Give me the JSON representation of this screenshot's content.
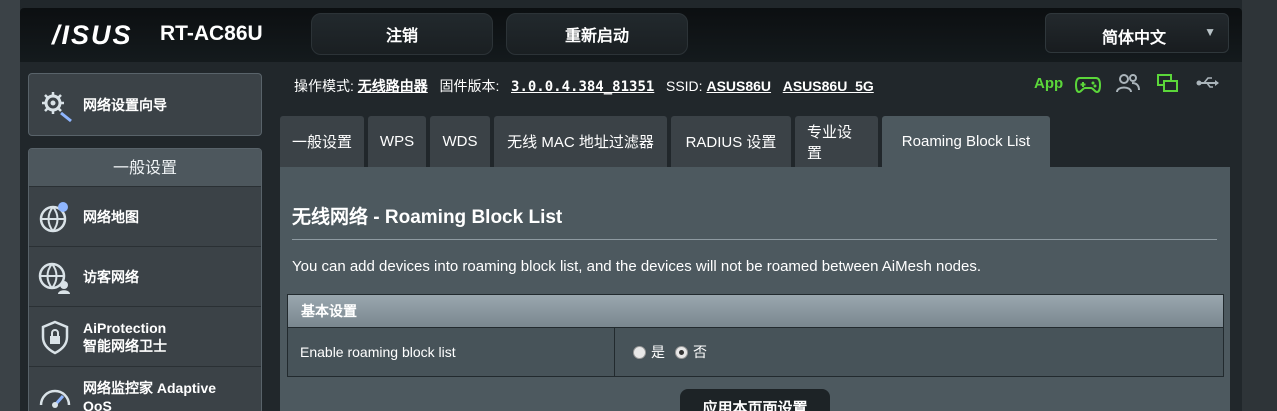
{
  "header": {
    "logo": "/ISUS",
    "model": "RT-AC86U",
    "logout_label": "注销",
    "reboot_label": "重新启动",
    "language": "简体中文"
  },
  "sidebar": {
    "wizard_label": "网络设置向导",
    "section_title": "一般设置",
    "items": [
      {
        "label": "网络地图",
        "icon": "globe-pin-icon"
      },
      {
        "label": "访客网络",
        "icon": "guest-network-icon"
      },
      {
        "label": "AiProtection\n智能网络卫士",
        "line1": "AiProtection",
        "line2": "智能网络卫士",
        "icon": "shield-lock-icon"
      },
      {
        "label": "网络监控家 Adaptive QoS",
        "line1": "网络监控家 Adaptive",
        "line2": "QoS",
        "icon": "speedometer-icon"
      }
    ]
  },
  "info": {
    "mode_label": "操作模式:",
    "mode_value": "无线路由器",
    "firmware_label": "固件版本:",
    "firmware_value": "3.0.0.4.384_81351",
    "ssid_label": "SSID:",
    "ssid_1": "ASUS86U",
    "ssid_2": "ASUS86U_5G",
    "app_label": "App"
  },
  "tabs": [
    {
      "label": "一般设置",
      "active": false
    },
    {
      "label": "WPS",
      "active": false
    },
    {
      "label": "WDS",
      "active": false
    },
    {
      "label": "无线 MAC 地址过滤器",
      "active": false
    },
    {
      "label": "RADIUS 设置",
      "active": false
    },
    {
      "label": "专业设置",
      "active": false
    },
    {
      "label": "Roaming Block List",
      "active": true
    }
  ],
  "panel": {
    "title": "无线网络 - Roaming Block List",
    "description": "You can add devices into roaming block list, and the devices will not be roamed between AiMesh nodes.",
    "table_header": "基本设置",
    "row_label": "Enable roaming block list",
    "option_yes": "是",
    "option_no": "否",
    "selected": "否",
    "apply_label": "应用本页面设置"
  },
  "colors": {
    "accent_green": "#5bd63a",
    "panel_bg": "#4d595f",
    "sidebar_bg": "#3b4247"
  }
}
